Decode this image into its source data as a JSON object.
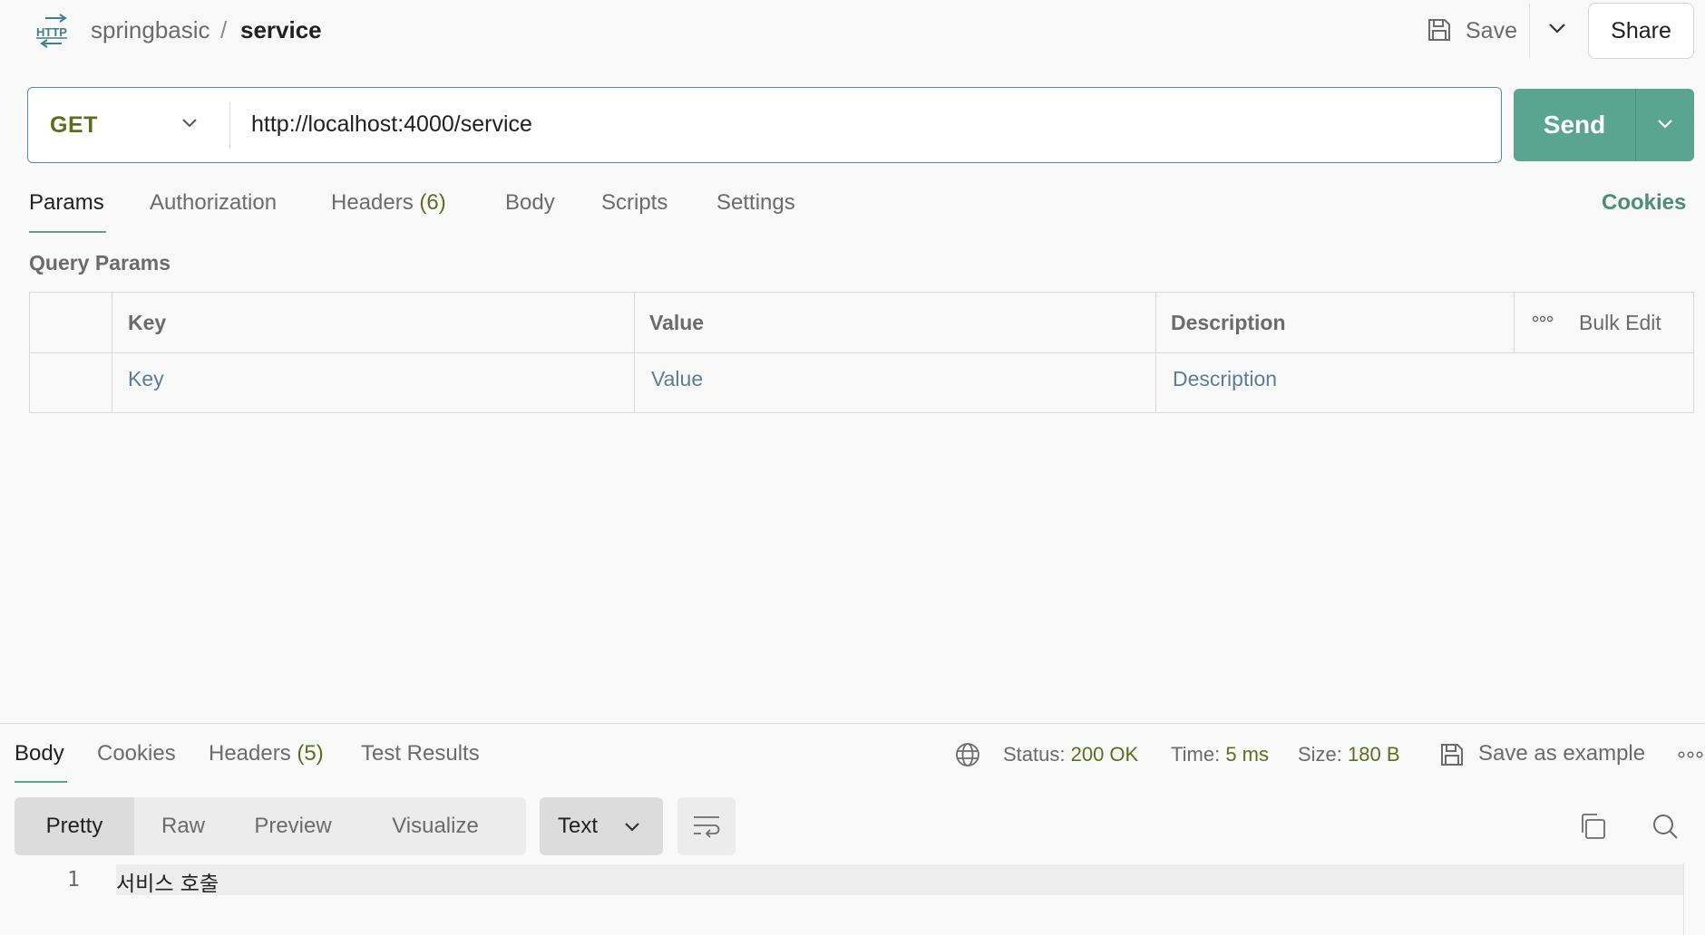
{
  "header": {
    "icon": "http-icon",
    "breadcrumb_parent": "springbasic",
    "breadcrumb_sep": "/",
    "breadcrumb_current": "service",
    "save_label": "Save",
    "share_label": "Share"
  },
  "request": {
    "method": "GET",
    "url": "http://localhost:4000/service",
    "send_label": "Send"
  },
  "request_tabs": {
    "params": "Params",
    "authorization": "Authorization",
    "headers": "Headers",
    "headers_count": "(6)",
    "body": "Body",
    "scripts": "Scripts",
    "settings": "Settings",
    "cookies": "Cookies",
    "active": "Params"
  },
  "query_params": {
    "title": "Query Params",
    "columns": [
      "Key",
      "Value",
      "Description"
    ],
    "bulk_edit": "Bulk Edit",
    "placeholders": {
      "key": "Key",
      "value": "Value",
      "description": "Description"
    }
  },
  "response": {
    "tabs": {
      "body": "Body",
      "cookies": "Cookies",
      "headers": "Headers",
      "headers_count": "(5)",
      "test_results": "Test Results",
      "active": "Body"
    },
    "status_label": "Status:",
    "status_value": "200 OK",
    "time_label": "Time:",
    "time_value": "5 ms",
    "size_label": "Size:",
    "size_value": "180 B",
    "save_example": "Save as example",
    "views": [
      "Pretty",
      "Raw",
      "Preview",
      "Visualize"
    ],
    "active_view": "Pretty",
    "format": "Text",
    "lines": [
      {
        "num": "1",
        "text": "서비스 호출"
      }
    ]
  },
  "colors": {
    "accent": "#5aa58f",
    "method_get": "#5c6f1f",
    "status_ok": "#5c6f1f",
    "placeholder": "#5a7d9a"
  }
}
